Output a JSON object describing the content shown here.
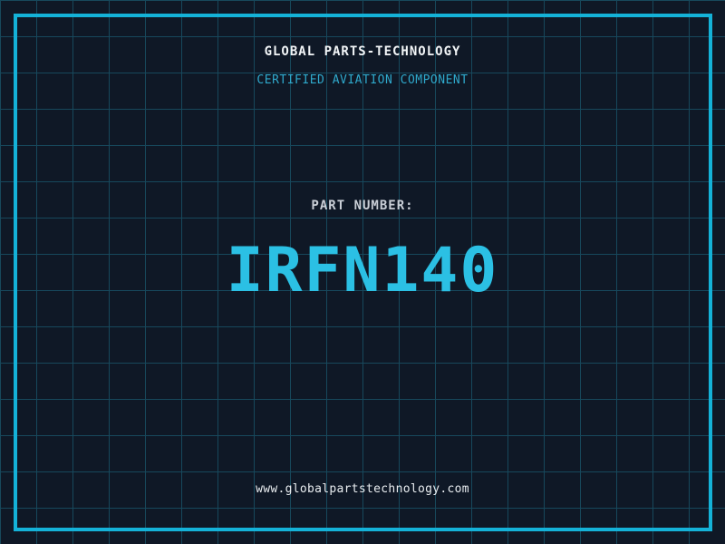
{
  "header": {
    "company_name": "GLOBAL PARTS-TECHNOLOGY",
    "certification": "CERTIFIED AVIATION COMPONENT"
  },
  "part": {
    "label": "PART NUMBER:",
    "number": "IRFN140"
  },
  "footer": {
    "website": "www.globalpartstechnology.com"
  },
  "colors": {
    "background": "#0f1826",
    "grid_line": "#17485c",
    "frame_border": "#14b2d8",
    "part_number_cyan": "#2bc0e4",
    "certification_cyan": "#2fa9cc",
    "title_white": "#f2f5f7",
    "label_gray": "#c9ced6"
  }
}
